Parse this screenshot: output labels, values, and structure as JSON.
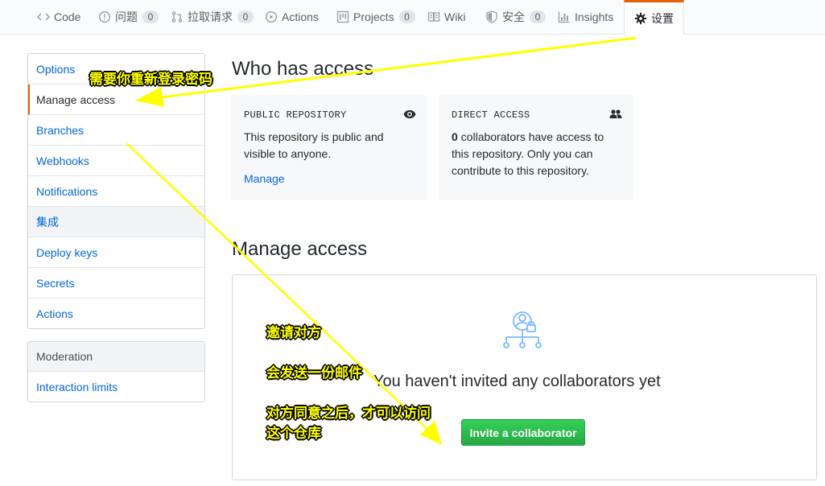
{
  "tabs": [
    {
      "label": "Code",
      "icon": "code-icon"
    },
    {
      "label": "问题",
      "icon": "issue-icon",
      "count": "0"
    },
    {
      "label": "拉取请求",
      "icon": "pull-request-icon",
      "count": "0"
    },
    {
      "label": "Actions",
      "icon": "play-icon"
    },
    {
      "label": "Projects",
      "icon": "project-icon",
      "count": "0"
    },
    {
      "label": "Wiki",
      "icon": "book-icon"
    },
    {
      "label": "安全",
      "icon": "shield-icon",
      "count": "0"
    },
    {
      "label": "Insights",
      "icon": "graph-icon"
    },
    {
      "label": "设置",
      "icon": "gear-icon",
      "selected": true
    }
  ],
  "sidebar": {
    "items": [
      {
        "label": "Options"
      },
      {
        "label": "Manage access",
        "selected": true
      },
      {
        "label": "Branches"
      },
      {
        "label": "Webhooks"
      },
      {
        "label": "Notifications"
      },
      {
        "label": "集成"
      },
      {
        "label": "Deploy keys"
      },
      {
        "label": "Secrets"
      },
      {
        "label": "Actions"
      }
    ],
    "moderation": {
      "heading": "Moderation",
      "items": [
        {
          "label": "Interaction limits"
        }
      ]
    }
  },
  "main": {
    "who_has_access_title": "Who has access",
    "public_card": {
      "label": "PUBLIC REPOSITORY",
      "text": "This repository is public and visible to anyone.",
      "link": "Manage"
    },
    "direct_card": {
      "label": "DIRECT ACCESS",
      "count": "0",
      "text": " collaborators have access to this repository. Only you can contribute to this repository."
    },
    "manage_access_title": "Manage access",
    "empty_message": "You haven't invited any collaborators yet",
    "invite_button": "Invite a collaborator"
  },
  "annotations": {
    "top": "需要你重新登录密码",
    "invite": "邀请对方",
    "email": "会发送一份邮件",
    "after_line1": "对方同意之后，才可以访问",
    "after_line2": "这个仓库"
  },
  "colors": {
    "accent": "#e36209",
    "link": "#0366d6",
    "button_green": "#28a745",
    "annotation_yellow": "#ffff00",
    "illustration_blue": "#79b8ff"
  }
}
